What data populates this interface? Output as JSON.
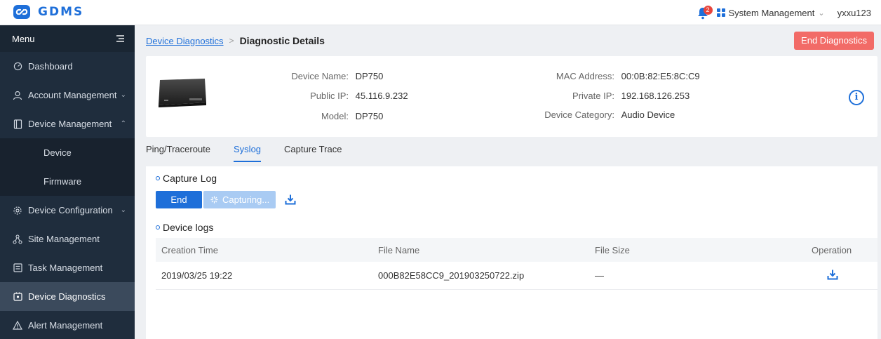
{
  "app": {
    "logo_text": "GDMS"
  },
  "header": {
    "notification_count": "2",
    "system_menu_label": "System Management",
    "username": "yxxu123"
  },
  "sidebar": {
    "menu_label": "Menu",
    "items": [
      {
        "label": "Dashboard"
      },
      {
        "label": "Account Management"
      },
      {
        "label": "Device Management"
      },
      {
        "label": "Device"
      },
      {
        "label": "Firmware"
      },
      {
        "label": "Device Configuration"
      },
      {
        "label": "Site Management"
      },
      {
        "label": "Task Management"
      },
      {
        "label": "Device Diagnostics"
      },
      {
        "label": "Alert Management"
      }
    ]
  },
  "breadcrumb": {
    "parent": "Device Diagnostics",
    "separator": ">",
    "current": "Diagnostic Details"
  },
  "actions": {
    "end_diagnostics": "End Diagnostics"
  },
  "device": {
    "name_label": "Device Name:",
    "name": "DP750",
    "public_ip_label": "Public IP:",
    "public_ip": "45.116.9.232",
    "model_label": "Model:",
    "model": "DP750",
    "mac_label": "MAC Address:",
    "mac": "00:0B:82:E5:8C:C9",
    "private_ip_label": "Private IP:",
    "private_ip": "192.168.126.253",
    "category_label": "Device Category:",
    "category": "Audio Device"
  },
  "tabs": [
    {
      "label": "Ping/Traceroute"
    },
    {
      "label": "Syslog"
    },
    {
      "label": "Capture Trace"
    }
  ],
  "capture": {
    "title": "Capture Log",
    "end_button": "End",
    "capturing_button": "Capturing..."
  },
  "logs": {
    "title": "Device logs",
    "columns": [
      "Creation Time",
      "File Name",
      "File Size",
      "Operation"
    ],
    "rows": [
      {
        "creation_time": "2019/03/25 19:22",
        "file_name": "000B82E58CC9_201903250722.zip",
        "file_size": "—"
      }
    ]
  },
  "colors": {
    "accent": "#1e6fd9",
    "danger": "#f26b67",
    "sidebar": "#1f2d3d"
  }
}
